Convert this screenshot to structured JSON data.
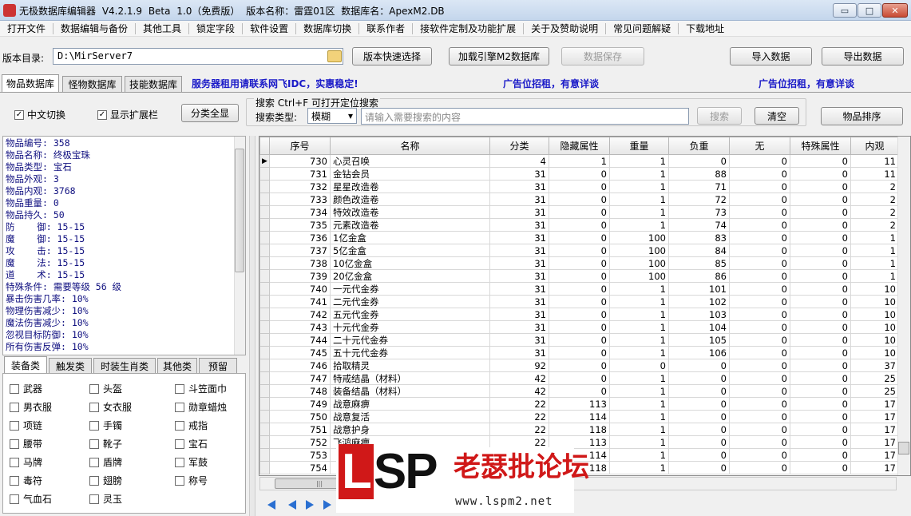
{
  "window": {
    "title": "无极数据库编辑器 V4.2.1.9    Beta 1.0（免费版）    版本名称：雷霆01区    数据库名：ApexM2.DB",
    "min": "▭",
    "max": "□",
    "close": "✕"
  },
  "menu": [
    "打开文件",
    "数据编辑与备份",
    "其他工具",
    "锁定字段",
    "软件设置",
    "数据库切换",
    "联系作者",
    "接软件定制及功能扩展",
    "关于及赞助说明",
    "常见问题解疑",
    "下载地址"
  ],
  "toolbar": {
    "version_dir_label": "版本目录:",
    "version_dir_value": "D:\\MirServer7",
    "quick_select": "版本快速选择",
    "load_engine": "加载引擎M2数据库",
    "save_data": "数据保存",
    "import": "导入数据",
    "export": "导出数据"
  },
  "tabs": [
    "物品数据库",
    "怪物数据库",
    "技能数据库"
  ],
  "ads": [
    "服务器租用请联系网飞IDC，实惠稳定!",
    "广告位招租，有意详谈",
    "广告位招租，有意详谈"
  ],
  "options": {
    "chinese_switch": "中文切换",
    "show_ext": "显示扩展栏",
    "check_mark": "✓",
    "show_all": "分类全显"
  },
  "search": {
    "title": "搜索  Ctrl+F 可打开定位搜索",
    "type_label": "搜索类型:",
    "type_value": "模糊",
    "placeholder": "请输入需要搜索的内容",
    "search_btn": "搜索",
    "clear_btn": "清空",
    "sort_btn": "物品排序"
  },
  "info_lines": [
    "物品编号: 358",
    "物品名称: 终极宝珠",
    "物品类型: 宝石",
    "物品外观: 3",
    "物品内观: 3768",
    "物品重量: 0",
    "物品持久: 50",
    "防    御: 15-15",
    "魔    御: 15-15",
    "攻    击: 15-15",
    "魔    法: 15-15",
    "道    术: 15-15",
    "特殊条件: 需要等级 56 级",
    "暴击伤害几率: 10%",
    "物理伤害减少: 10%",
    "魔法伤害减少: 10%",
    "忽视目标防御: 10%",
    "所有伤害反弹: 10%"
  ],
  "category_tabs": [
    "装备类",
    "触发类",
    "时装生肖类",
    "其他类",
    "预留"
  ],
  "categories": [
    [
      "武器",
      "头盔",
      "斗笠面巾"
    ],
    [
      "男衣服",
      "女衣服",
      "勋章蜡烛"
    ],
    [
      "项链",
      "手镯",
      "戒指"
    ],
    [
      "腰带",
      "靴子",
      "宝石"
    ],
    [
      "马牌",
      "盾牌",
      "军鼓"
    ],
    [
      "毒符",
      "翅膀",
      "称号"
    ],
    [
      "气血石",
      "灵玉"
    ]
  ],
  "grid": {
    "columns": [
      "序号",
      "名称",
      "分类",
      "隐藏属性",
      "重量",
      "负重",
      "无",
      "特殊属性",
      "内观"
    ],
    "row_indicator": "▶",
    "rows": [
      [
        730,
        "心灵召唤",
        4,
        1,
        1,
        0,
        0,
        0,
        11
      ],
      [
        731,
        "金钻会员",
        31,
        0,
        1,
        88,
        0,
        0,
        11
      ],
      [
        732,
        "星星改造卷",
        31,
        0,
        1,
        71,
        0,
        0,
        2
      ],
      [
        733,
        "颜色改造卷",
        31,
        0,
        1,
        72,
        0,
        0,
        2
      ],
      [
        734,
        "特效改造卷",
        31,
        0,
        1,
        73,
        0,
        0,
        2
      ],
      [
        735,
        "元素改造卷",
        31,
        0,
        1,
        74,
        0,
        0,
        2
      ],
      [
        736,
        "1亿金盒",
        31,
        0,
        100,
        83,
        0,
        0,
        1
      ],
      [
        737,
        "5亿金盒",
        31,
        0,
        100,
        84,
        0,
        0,
        1
      ],
      [
        738,
        "10亿金盒",
        31,
        0,
        100,
        85,
        0,
        0,
        1
      ],
      [
        739,
        "20亿金盒",
        31,
        0,
        100,
        86,
        0,
        0,
        1
      ],
      [
        740,
        "一元代金券",
        31,
        0,
        1,
        101,
        0,
        0,
        10
      ],
      [
        741,
        "二元代金券",
        31,
        0,
        1,
        102,
        0,
        0,
        10
      ],
      [
        742,
        "五元代金券",
        31,
        0,
        1,
        103,
        0,
        0,
        10
      ],
      [
        743,
        "十元代金券",
        31,
        0,
        1,
        104,
        0,
        0,
        10
      ],
      [
        744,
        "二十元代金券",
        31,
        0,
        1,
        105,
        0,
        0,
        10
      ],
      [
        745,
        "五十元代金券",
        31,
        0,
        1,
        106,
        0,
        0,
        10
      ],
      [
        746,
        "拾取精灵",
        92,
        0,
        0,
        0,
        0,
        0,
        37
      ],
      [
        747,
        "特戒结晶（材料）",
        42,
        0,
        1,
        0,
        0,
        0,
        25
      ],
      [
        748,
        "装备结晶（材料）",
        42,
        0,
        1,
        0,
        0,
        0,
        25
      ],
      [
        749,
        "战意麻痹",
        22,
        113,
        1,
        0,
        0,
        0,
        17
      ],
      [
        750,
        "战意复活",
        22,
        114,
        1,
        0,
        0,
        0,
        17
      ],
      [
        751,
        "战意护身",
        22,
        118,
        1,
        0,
        0,
        0,
        17
      ],
      [
        752,
        "飞鸿麻痹",
        22,
        113,
        1,
        0,
        0,
        0,
        17
      ],
      [
        753,
        "",
        22,
        114,
        1,
        0,
        0,
        0,
        17
      ],
      [
        754,
        "",
        22,
        118,
        1,
        0,
        0,
        0,
        17
      ]
    ]
  },
  "hscroll_grip": "|||",
  "watermark": {
    "l": "L",
    "sp": "SP",
    "cn": "老瑟批论坛",
    "url": "www.lspm2.net"
  }
}
